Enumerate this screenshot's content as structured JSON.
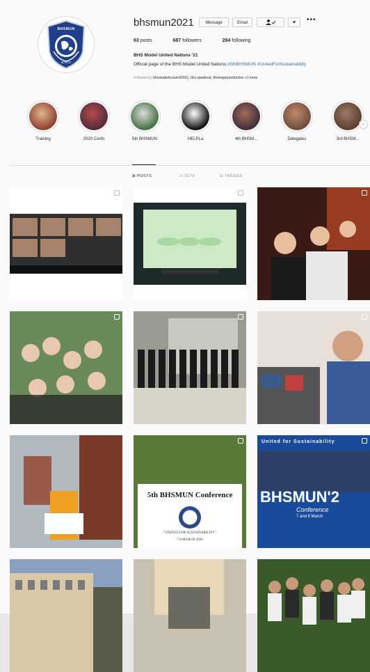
{
  "profile": {
    "username": "bhsmun2021",
    "buttons": {
      "message": "Message",
      "email": "Email",
      "more": "•••"
    },
    "stats": [
      {
        "count": "63",
        "label": "posts"
      },
      {
        "count": "687",
        "label": "followers"
      },
      {
        "count": "294",
        "label": "following"
      }
    ],
    "full_name": "BHS Model United Nations '21",
    "bio_text": "Official page of the BHS Model United Nations",
    "bio_tags": "#5thBHSMUN #UnitedForSustainability",
    "followed_by_prefix": "Followed by",
    "followed_by_names": "bhsstudentcouncil2021, bhs.speakout, bhsmajorproduction",
    "followed_by_more": "+1 more",
    "avatar_text": {
      "top": "BHSMUN",
      "bottom": "BEYKOZ"
    }
  },
  "highlights": [
    {
      "label": "Training",
      "colors": [
        "#8a3a2c",
        "#e2b48a"
      ]
    },
    {
      "label": "2020 Confs",
      "colors": [
        "#4a2a3a",
        "#b84a4a"
      ]
    },
    {
      "label": "5th BHSMUN",
      "colors": [
        "#3b6a3b",
        "#dcdcdc"
      ]
    },
    {
      "label": "HELPLa",
      "colors": [
        "#000000",
        "#ffffff"
      ]
    },
    {
      "label": "4th BHSM...",
      "colors": [
        "#3a2a3a",
        "#a46a5a"
      ]
    },
    {
      "label": "Delegates",
      "colors": [
        "#6a4a3a",
        "#c08a6a"
      ]
    },
    {
      "label": "3rd BHSM...",
      "colors": [
        "#5a3a2a",
        "#9a7a6a"
      ]
    }
  ],
  "tabs": [
    {
      "label": "POSTS",
      "icon": "grid-icon"
    },
    {
      "label": "IGTV",
      "icon": "tv-icon"
    },
    {
      "label": "TAGGED",
      "icon": "tag-icon"
    }
  ],
  "posts": [
    {
      "name": "post-zoom-call",
      "multi": true,
      "colors": [
        "#ffffff",
        "#2f2f2f",
        "#c49a7a"
      ]
    },
    {
      "name": "post-rules-of-procedure",
      "multi": true,
      "colors": [
        "#ffffff",
        "#1e2a2a",
        "#cfe8c8"
      ]
    },
    {
      "name": "post-delegates-cheering",
      "multi": true,
      "colors": [
        "#3a1a14",
        "#c04a2a",
        "#e8c0a0"
      ]
    },
    {
      "name": "post-group-selfie",
      "multi": true,
      "colors": [
        "#6a8a5a",
        "#e8c8b0",
        "#2a2a2a"
      ]
    },
    {
      "name": "post-group-in-front-of-building",
      "multi": true,
      "colors": [
        "#9a9a90",
        "#1a1a1a",
        "#d8d4c8"
      ]
    },
    {
      "name": "post-laptop-stickers",
      "multi": true,
      "colors": [
        "#e8e0d8",
        "#3a5a8a",
        "#d0a080"
      ]
    },
    {
      "name": "post-student-with-flag",
      "multi": false,
      "colors": [
        "#b0b8c0",
        "#f0a020",
        "#7a3a2a"
      ]
    },
    {
      "name": "post-conference-announcement",
      "multi": true,
      "colors": [
        "#5a7a3a",
        "#ffffff",
        "#2a4a8a"
      ],
      "title": "5th BHSMUN Conference",
      "motto": "\"UNITED FOR SUSTAINABILITY\"",
      "date": "7-8 MARCH 2020"
    },
    {
      "name": "post-bhsmun-poster",
      "multi": true,
      "colors": [
        "#1a4a9a",
        "#ffffff",
        "#3a3a4a"
      ],
      "heading": "United for Sustainability",
      "wordmark": "BHSMUN'2",
      "subtitle": "Conference",
      "dates": "7 and 8 March"
    },
    {
      "name": "post-school-building",
      "multi": false,
      "colors": [
        "#d8c8a8",
        "#8aa0c0",
        "#5a5a4a"
      ]
    },
    {
      "name": "post-courtyard",
      "multi": false,
      "colors": [
        "#c8c0b0",
        "#6a6a60",
        "#a89070"
      ]
    },
    {
      "name": "post-group-photo-garden",
      "multi": false,
      "colors": [
        "#3a5a2a",
        "#f0f0f0",
        "#2a2a2a"
      ]
    }
  ]
}
